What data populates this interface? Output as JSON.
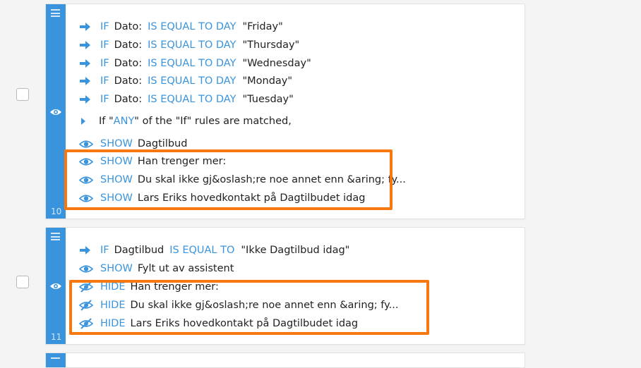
{
  "rules": [
    {
      "number": "10",
      "conditions": [
        {
          "keyword": "IF",
          "field": "Dato:",
          "operator": "IS EQUAL TO DAY",
          "value": "\"Friday\""
        },
        {
          "keyword": "IF",
          "field": "Dato:",
          "operator": "IS EQUAL TO DAY",
          "value": "\"Thursday\""
        },
        {
          "keyword": "IF",
          "field": "Dato:",
          "operator": "IS EQUAL TO DAY",
          "value": "\"Wednesday\""
        },
        {
          "keyword": "IF",
          "field": "Dato:",
          "operator": "IS EQUAL TO DAY",
          "value": "\"Monday\""
        },
        {
          "keyword": "IF",
          "field": "Dato:",
          "operator": "IS EQUAL TO DAY",
          "value": "\"Tuesday\""
        }
      ],
      "match": {
        "before": "If \"",
        "mode": "ANY",
        "after": "\" of the \"If\" rules are matched,"
      },
      "actions": [
        {
          "keyword": "SHOW",
          "target": "Dagtilbud"
        },
        {
          "keyword": "SHOW",
          "target": "Han trenger mer:"
        },
        {
          "keyword": "SHOW",
          "target": "Du skal ikke gj&oslash;re noe annet enn &aring; fy..."
        },
        {
          "keyword": "SHOW",
          "target": "Lars Eriks hovedkontakt på Dagtilbudet idag"
        }
      ]
    },
    {
      "number": "11",
      "conditions": [
        {
          "keyword": "IF",
          "field": "Dagtilbud",
          "operator": "IS EQUAL TO",
          "value": "\"Ikke Dagtilbud idag\""
        }
      ],
      "actions": [
        {
          "keyword": "SHOW",
          "target": "Fylt ut av assistent"
        },
        {
          "keyword": "HIDE",
          "target": "Han trenger mer:"
        },
        {
          "keyword": "HIDE",
          "target": "Du skal ikke gj&oslash;re noe annet enn &aring; fy..."
        },
        {
          "keyword": "HIDE",
          "target": "Lars Eriks hovedkontakt på Dagtilbudet idag"
        }
      ]
    }
  ],
  "colors": {
    "accent": "#3a94dd",
    "highlight": "#f7780f"
  }
}
